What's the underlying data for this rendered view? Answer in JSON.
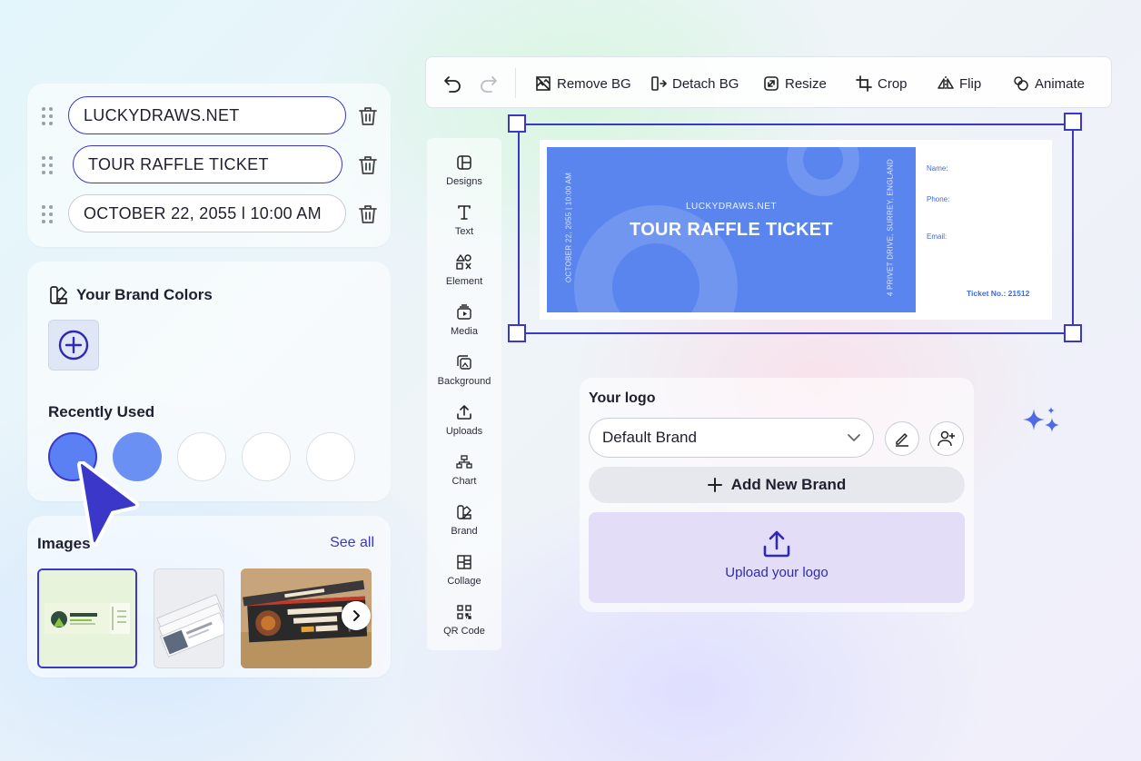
{
  "text_fields": [
    {
      "value": "LUCKYDRAWS.NET",
      "active": true
    },
    {
      "value": "TOUR RAFFLE TICKET",
      "active": true
    },
    {
      "value": "OCTOBER 22, 2055 l 10:00 AM",
      "active": false
    }
  ],
  "brand_colors": {
    "title": "Your Brand Colors",
    "recently_used_title": "Recently Used",
    "recent_colors": [
      "#5a80f3",
      "#6a90f4",
      "#ffffff",
      "#ffffff",
      "#ffffff"
    ],
    "selected_index": 0
  },
  "images": {
    "title": "Images",
    "see_all": "See all"
  },
  "toolbar": {
    "remove_bg": "Remove BG",
    "detach_bg": "Detach BG",
    "resize": "Resize",
    "crop": "Crop",
    "flip": "Flip",
    "animate": "Animate"
  },
  "rail": {
    "items": [
      "Designs",
      "Text",
      "Element",
      "Media",
      "Background",
      "Uploads",
      "Chart",
      "Brand",
      "Collage",
      "QR Code"
    ]
  },
  "ticket": {
    "site": "LUCKYDRAWS.NET",
    "title": "TOUR RAFFLE TICKET",
    "date_vertical": "OCTOBER 22, 2055 | 10:00 AM",
    "address_vertical": "4 PRIVET DRIVE, SURREY, ENGLAND",
    "name_label": "Name:",
    "phone_label": "Phone:",
    "email_label": "Email:",
    "ticket_no": "Ticket No.: 21512",
    "color": "#5a85ee"
  },
  "logo_panel": {
    "title": "Your logo",
    "selected_brand": "Default Brand",
    "add_new_brand": "Add New Brand",
    "upload_label": "Upload your logo"
  },
  "colors": {
    "accent": "#3b37c9",
    "ticket_blue": "#5a85ee"
  }
}
